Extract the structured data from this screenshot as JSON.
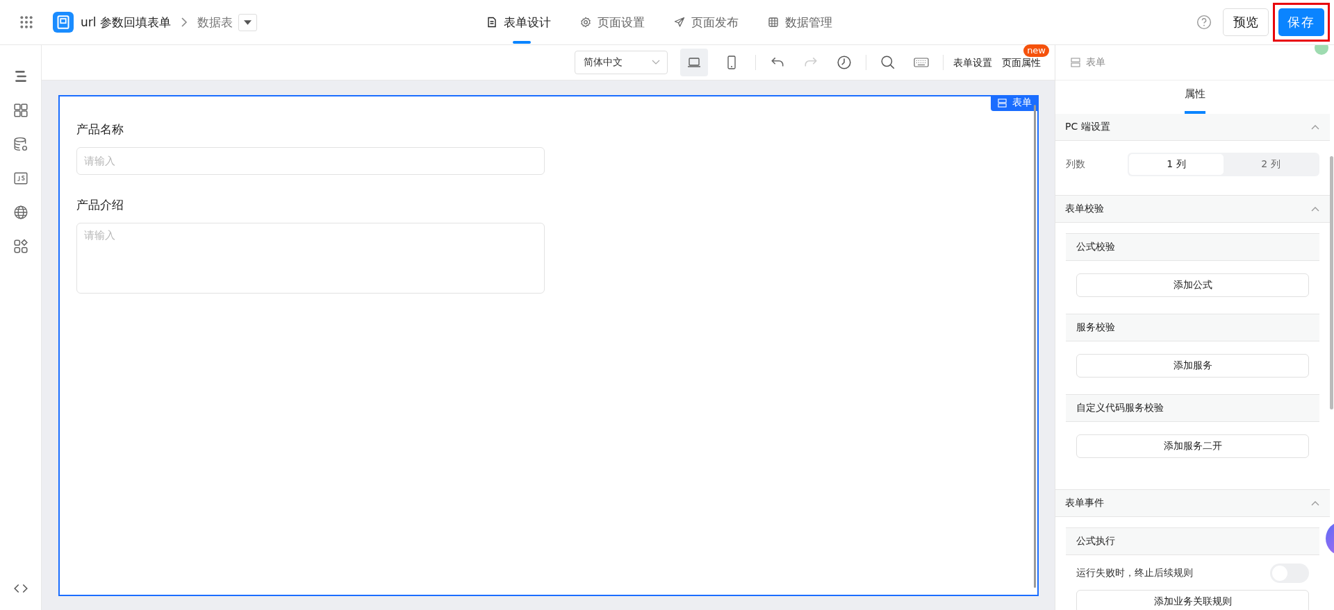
{
  "header": {
    "app_title": "url 参数回填表单",
    "breadcrumb": "数据表",
    "nav_tabs": [
      {
        "label": "表单设计",
        "selected": true
      },
      {
        "label": "页面设置",
        "selected": false
      },
      {
        "label": "页面发布",
        "selected": false
      },
      {
        "label": "数据管理",
        "selected": false
      }
    ],
    "preview_button": "预览",
    "save_button": "保存",
    "save_highlighted": true
  },
  "toolbar": {
    "language": "简体中文",
    "devices": [
      {
        "selected": true
      },
      {
        "selected": false
      }
    ],
    "redo_disabled": true,
    "links": [
      {
        "label": "表单设置"
      },
      {
        "label": "页面属性",
        "badge": "new"
      }
    ]
  },
  "form": {
    "badge": "表单",
    "fields": [
      {
        "kind": "input",
        "label": "产品名称",
        "placeholder": "请输入"
      },
      {
        "kind": "textarea",
        "label": "产品介绍",
        "placeholder": "请输入"
      }
    ]
  },
  "right_panel": {
    "component": "表单",
    "tabs": [
      {
        "label": "属性",
        "selected": true
      }
    ],
    "sections": [
      {
        "title": "PC 端设置",
        "expanded": true,
        "rows": [
          {
            "kind": "segmented",
            "label": "列数",
            "options": [
              {
                "label": "1 列",
                "selected": true
              },
              {
                "label": "2 列",
                "selected": false
              }
            ]
          }
        ]
      },
      {
        "title": "表单校验",
        "expanded": true,
        "rows": [
          {
            "kind": "subheader",
            "label": "公式校验"
          },
          {
            "kind": "button",
            "label": "添加公式"
          },
          {
            "kind": "subheader",
            "label": "服务校验"
          },
          {
            "kind": "button",
            "label": "添加服务"
          },
          {
            "kind": "subheader",
            "label": "自定义代码服务校验"
          },
          {
            "kind": "button",
            "label": "添加服务二开"
          }
        ]
      },
      {
        "title": "表单事件",
        "expanded": true,
        "rows": [
          {
            "kind": "subheader",
            "label": "公式执行"
          },
          {
            "kind": "toggle",
            "label": "运行失败时，终止后续规则",
            "on": false
          },
          {
            "kind": "button",
            "label": "添加业务关联规则"
          }
        ]
      }
    ]
  }
}
